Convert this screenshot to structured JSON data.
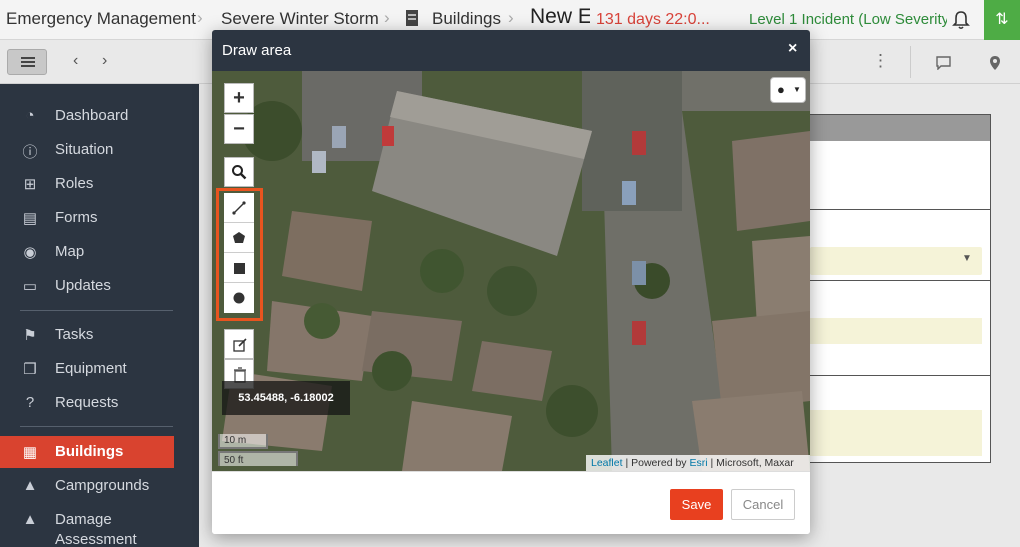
{
  "header": {
    "breadcrumbs": [
      "Emergency Management",
      "Severe Winter Storm",
      "Buildings"
    ],
    "page_title": "New E",
    "timer": "131 days 22:0...",
    "incident_level": "Level 1 Incident (Low Severity)"
  },
  "sidebar": {
    "items": [
      {
        "label": "Dashboard",
        "icon": "dashboard-icon"
      },
      {
        "label": "Situation",
        "icon": "info-icon"
      },
      {
        "label": "Roles",
        "icon": "org-chart-icon"
      },
      {
        "label": "Forms",
        "icon": "form-icon"
      },
      {
        "label": "Map",
        "icon": "globe-icon"
      },
      {
        "label": "Updates",
        "icon": "chat-icon"
      },
      {
        "label": "Tasks",
        "icon": "flag-icon"
      },
      {
        "label": "Equipment",
        "icon": "cubes-icon"
      },
      {
        "label": "Requests",
        "icon": "question-icon"
      },
      {
        "label": "Buildings",
        "icon": "building-icon",
        "active": true
      },
      {
        "label": "Campgrounds",
        "icon": "campground-icon"
      },
      {
        "label": "Damage Assessment",
        "icon": "warning-icon"
      }
    ]
  },
  "modal": {
    "title": "Draw area",
    "close_symbol": "×",
    "zoom_in": "+",
    "zoom_out": "−",
    "coordinates": "53.45488, -6.18002",
    "scale_metric": "10 m",
    "scale_imperial": "50 ft",
    "attribution": {
      "leaflet": "Leaflet",
      "powered_by": "| Powered by",
      "esri": "Esri",
      "providers": "| Microsoft, Maxar"
    },
    "save_label": "Save",
    "cancel_label": "Cancel"
  },
  "colors": {
    "accent": "#e8401f",
    "sidebar_bg": "#2c3541",
    "incident_green": "#2e8b3a",
    "timer_red": "#d9433a",
    "highlight_border": "#e8541f"
  }
}
